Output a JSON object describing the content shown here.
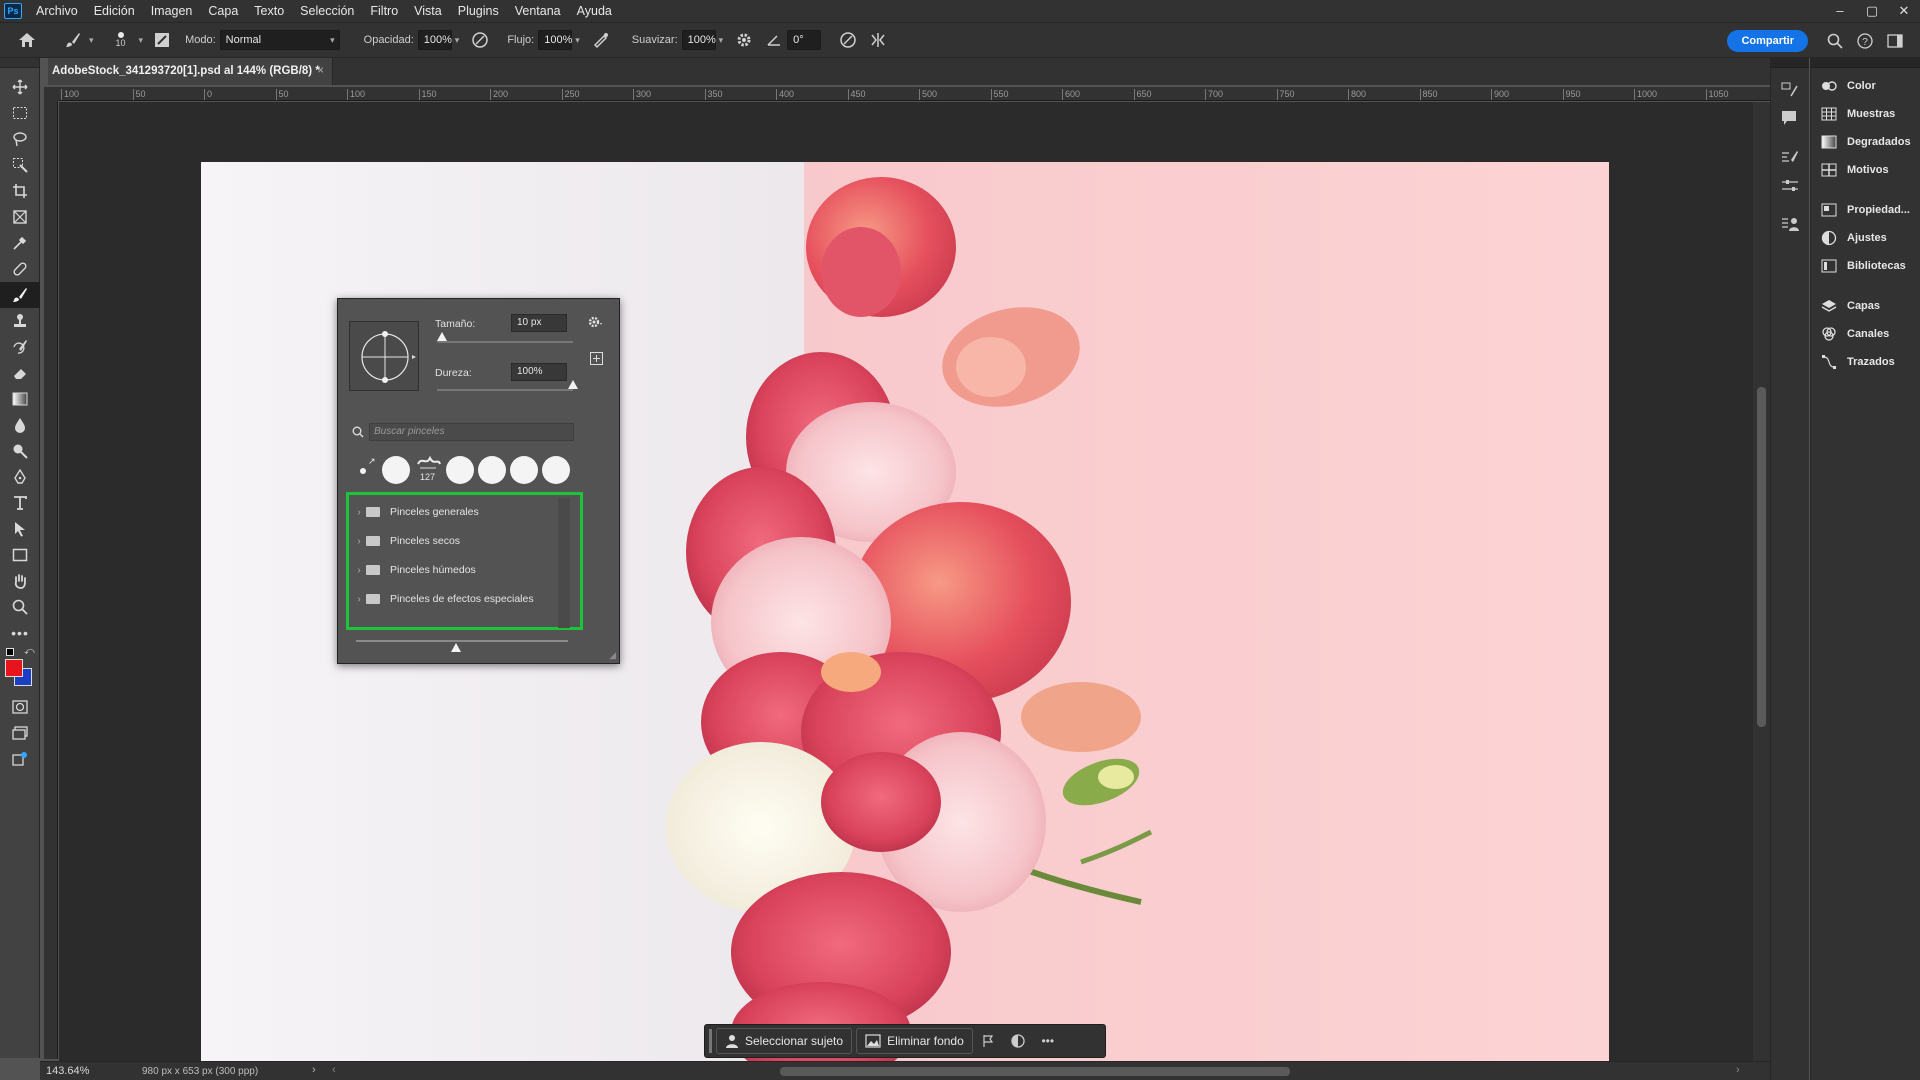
{
  "app": {
    "logo": "Ps"
  },
  "menu": [
    "Archivo",
    "Edición",
    "Imagen",
    "Capa",
    "Texto",
    "Selección",
    "Filtro",
    "Vista",
    "Plugins",
    "Ventana",
    "Ayuda"
  ],
  "window_controls": [
    "–",
    "▢",
    "✕"
  ],
  "options_bar": {
    "brush_size": "10",
    "mode_label": "Modo:",
    "mode_value": "Normal",
    "opacity_label": "Opacidad:",
    "opacity_value": "100%",
    "flow_label": "Flujo:",
    "flow_value": "100%",
    "smoothing_label": "Suavizar:",
    "smoothing_value": "100%",
    "angle_value": "0°",
    "share_label": "Compartir"
  },
  "document": {
    "tab_title": "AdobeStock_341293720[1].psd al 144% (RGB/8) *",
    "tab_close": "×",
    "ruler_labels": [
      "100",
      "50",
      "0",
      "50",
      "100",
      "150",
      "200",
      "250",
      "300",
      "350",
      "400",
      "450",
      "500",
      "550",
      "600",
      "650",
      "700",
      "750",
      "800",
      "850",
      "900",
      "950",
      "1000",
      "1050"
    ]
  },
  "status": {
    "zoom": "143.64%",
    "doc_info": "980 px x 653 px (300 ppp)"
  },
  "brush_popup": {
    "size_label": "Tamaño:",
    "size_value": "10 px",
    "size_level": 0.04,
    "hardness_label": "Dureza:",
    "hardness_value": "100%",
    "hardness_level": 1.0,
    "search_placeholder": "Buscar pinceles",
    "preset_count_label": "127",
    "folders": [
      "Pinceles generales",
      "Pinceles secos",
      "Pinceles húmedos",
      "Pinceles de efectos especiales"
    ],
    "highlight_color": "#1dc43a"
  },
  "context_bar": {
    "select_subject": "Seleccionar sujeto",
    "remove_bg": "Eliminar fondo",
    "more": "•••"
  },
  "panels": [
    "Color",
    "Muestras",
    "Degradados",
    "Motivos",
    "Propiedad...",
    "Ajustes",
    "Bibliotecas",
    "Capas",
    "Canales",
    "Trazados"
  ],
  "colors": {
    "foreground": "#e8141c",
    "background": "#1a3fc4",
    "accent": "#1473e6"
  }
}
